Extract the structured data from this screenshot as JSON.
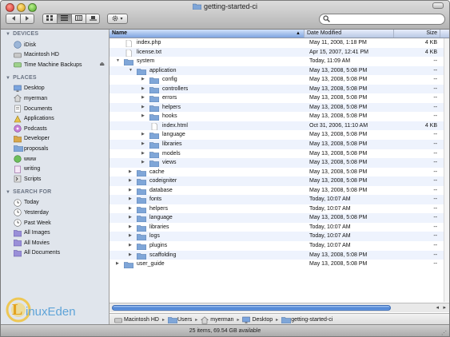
{
  "window": {
    "title": "getting-started-ci"
  },
  "toolbar": {
    "search_placeholder": "",
    "action_label": "✱▾"
  },
  "sidebar": {
    "devices": {
      "label": "DEVICES",
      "items": [
        {
          "label": "iDisk",
          "icon": "idisk-icon"
        },
        {
          "label": "Macintosh HD",
          "icon": "hard-disk-icon"
        },
        {
          "label": "Time Machine Backups",
          "icon": "backup-disk-icon",
          "eject": "⏏"
        }
      ]
    },
    "places": {
      "label": "PLACES",
      "items": [
        {
          "label": "Desktop",
          "icon": "desktop-icon"
        },
        {
          "label": "myerman",
          "icon": "home-icon"
        },
        {
          "label": "Documents",
          "icon": "documents-icon"
        },
        {
          "label": "Applications",
          "icon": "applications-icon"
        },
        {
          "label": "Podcasts",
          "icon": "podcasts-icon"
        },
        {
          "label": "Developer",
          "icon": "developer-icon"
        },
        {
          "label": "proposals",
          "icon": "folder-icon"
        },
        {
          "label": "www",
          "icon": "www-icon"
        },
        {
          "label": "writing",
          "icon": "writing-icon"
        },
        {
          "label": "Scripts",
          "icon": "scripts-icon"
        }
      ]
    },
    "search_for": {
      "label": "SEARCH FOR",
      "items": [
        {
          "label": "Today",
          "icon": "clock-icon"
        },
        {
          "label": "Yesterday",
          "icon": "clock-icon"
        },
        {
          "label": "Past Week",
          "icon": "clock-icon"
        },
        {
          "label": "All Images",
          "icon": "smart-folder-icon"
        },
        {
          "label": "All Movies",
          "icon": "smart-folder-icon"
        },
        {
          "label": "All Documents",
          "icon": "smart-folder-icon"
        }
      ]
    }
  },
  "columns": {
    "name": "Name",
    "date": "Date Modified",
    "size": "Size",
    "sort_indicator": "▲"
  },
  "rows": [
    {
      "name": "index.php",
      "date": "May 11, 2008, 1:18 PM",
      "size": "4 KB",
      "depth": 0,
      "kind": "file",
      "disc": ""
    },
    {
      "name": "license.txt",
      "date": "Apr 15, 2007, 12:41 PM",
      "size": "4 KB",
      "depth": 0,
      "kind": "file",
      "disc": ""
    },
    {
      "name": "system",
      "date": "Today, 11:09 AM",
      "size": "--",
      "depth": 0,
      "kind": "folder",
      "disc": "▼"
    },
    {
      "name": "application",
      "date": "May 13, 2008, 5:08 PM",
      "size": "--",
      "depth": 1,
      "kind": "folder",
      "disc": "▼"
    },
    {
      "name": "config",
      "date": "May 13, 2008, 5:08 PM",
      "size": "--",
      "depth": 2,
      "kind": "folder",
      "disc": "▶"
    },
    {
      "name": "controllers",
      "date": "May 13, 2008, 5:08 PM",
      "size": "--",
      "depth": 2,
      "kind": "folder",
      "disc": "▶"
    },
    {
      "name": "errors",
      "date": "May 13, 2008, 5:08 PM",
      "size": "--",
      "depth": 2,
      "kind": "folder",
      "disc": "▶"
    },
    {
      "name": "helpers",
      "date": "May 13, 2008, 5:08 PM",
      "size": "--",
      "depth": 2,
      "kind": "folder",
      "disc": "▶"
    },
    {
      "name": "hooks",
      "date": "May 13, 2008, 5:08 PM",
      "size": "--",
      "depth": 2,
      "kind": "folder",
      "disc": "▶"
    },
    {
      "name": "index.html",
      "date": "Oct 31, 2006, 11:10 AM",
      "size": "4 KB",
      "depth": 2,
      "kind": "file",
      "disc": ""
    },
    {
      "name": "language",
      "date": "May 13, 2008, 5:08 PM",
      "size": "--",
      "depth": 2,
      "kind": "folder",
      "disc": "▶"
    },
    {
      "name": "libraries",
      "date": "May 13, 2008, 5:08 PM",
      "size": "--",
      "depth": 2,
      "kind": "folder",
      "disc": "▶"
    },
    {
      "name": "models",
      "date": "May 13, 2008, 5:08 PM",
      "size": "--",
      "depth": 2,
      "kind": "folder",
      "disc": "▶"
    },
    {
      "name": "views",
      "date": "May 13, 2008, 5:08 PM",
      "size": "--",
      "depth": 2,
      "kind": "folder",
      "disc": "▶"
    },
    {
      "name": "cache",
      "date": "May 13, 2008, 5:08 PM",
      "size": "--",
      "depth": 1,
      "kind": "folder",
      "disc": "▶"
    },
    {
      "name": "codeigniter",
      "date": "May 13, 2008, 5:08 PM",
      "size": "--",
      "depth": 1,
      "kind": "folder",
      "disc": "▶"
    },
    {
      "name": "database",
      "date": "May 13, 2008, 5:08 PM",
      "size": "--",
      "depth": 1,
      "kind": "folder",
      "disc": "▶"
    },
    {
      "name": "fonts",
      "date": "Today, 10:07 AM",
      "size": "--",
      "depth": 1,
      "kind": "folder",
      "disc": "▶"
    },
    {
      "name": "helpers",
      "date": "Today, 10:07 AM",
      "size": "--",
      "depth": 1,
      "kind": "folder",
      "disc": "▶"
    },
    {
      "name": "language",
      "date": "May 13, 2008, 5:08 PM",
      "size": "--",
      "depth": 1,
      "kind": "folder",
      "disc": "▶"
    },
    {
      "name": "libraries",
      "date": "Today, 10:07 AM",
      "size": "--",
      "depth": 1,
      "kind": "folder",
      "disc": "▶"
    },
    {
      "name": "logs",
      "date": "Today, 10:07 AM",
      "size": "--",
      "depth": 1,
      "kind": "folder",
      "disc": "▶"
    },
    {
      "name": "plugins",
      "date": "Today, 10:07 AM",
      "size": "--",
      "depth": 1,
      "kind": "folder",
      "disc": "▶"
    },
    {
      "name": "scaffolding",
      "date": "May 13, 2008, 5:08 PM",
      "size": "--",
      "depth": 1,
      "kind": "folder",
      "disc": "▶"
    },
    {
      "name": "user_guide",
      "date": "May 13, 2008, 5:08 PM",
      "size": "--",
      "depth": 0,
      "kind": "folder",
      "disc": "▶"
    }
  ],
  "pathbar": [
    {
      "label": "Macintosh HD",
      "icon": "hard-disk-icon"
    },
    {
      "label": "Users",
      "icon": "folder-icon"
    },
    {
      "label": "myerman",
      "icon": "home-icon"
    },
    {
      "label": "Desktop",
      "icon": "desktop-icon"
    },
    {
      "label": "getting-started-ci",
      "icon": "folder-icon"
    }
  ],
  "status": "25 items, 69.54 GB available",
  "watermark": {
    "text": "inuxEden",
    "lead": "L"
  },
  "colors": {
    "selection": "#4b82d2",
    "sidebar_bg": "#e0e5ec",
    "folder": "#7fa6d8"
  }
}
